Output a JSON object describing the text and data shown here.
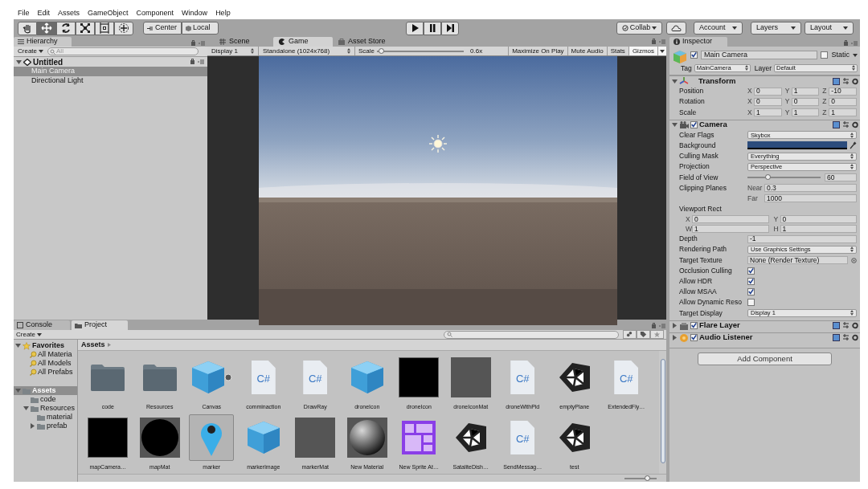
{
  "menu": [
    "File",
    "Edit",
    "Assets",
    "GameObject",
    "Component",
    "Window",
    "Help"
  ],
  "toolbar": {
    "tools": [
      {
        "kind": "hand",
        "selected": false
      },
      {
        "kind": "move",
        "selected": true
      },
      {
        "kind": "rotate",
        "selected": false
      },
      {
        "kind": "scale",
        "selected": false
      },
      {
        "kind": "rect",
        "selected": false
      },
      {
        "kind": "transform",
        "selected": false
      }
    ],
    "pivot": [
      "Center",
      "Local"
    ],
    "collab": "Collab",
    "account": "Account",
    "layers": "Layers",
    "layout": "Layout"
  },
  "hierarchy": {
    "tab": "Hierarchy",
    "create": "Create",
    "search_placeholder": "All",
    "scene": {
      "name": "Untitled",
      "expanded": true,
      "children": [
        {
          "name": "Main Camera",
          "selected": true
        },
        {
          "name": "Directional Light",
          "selected": false
        }
      ]
    }
  },
  "center_tabs": [
    {
      "kind": "scene",
      "label": "Scene",
      "selected": false
    },
    {
      "kind": "game",
      "label": "Game",
      "selected": true
    },
    {
      "kind": "store",
      "label": "Asset Store",
      "selected": false
    }
  ],
  "game_bar": {
    "display": "Display 1",
    "resolution": "Standalone (1024x768)",
    "scale": {
      "label": "Scale",
      "level": 0.02,
      "reading": "0.6x"
    },
    "toggles": [
      {
        "label": "Maximize On Play",
        "on": false
      },
      {
        "label": "Mute Audio",
        "on": false
      },
      {
        "label": "Stats",
        "on": false
      },
      {
        "label": "Gizmos",
        "on": true
      }
    ]
  },
  "inspector": {
    "tab": "Inspector",
    "object": {
      "active": true,
      "name": "Main Camera",
      "static": false,
      "static_label": "Static",
      "tag_label": "Tag",
      "tag": "MainCamera",
      "layer_label": "Layer",
      "layer": "Default"
    },
    "components": [
      {
        "kind": "transform",
        "name": "Transform",
        "expanded": true,
        "rows": [
          {
            "kind": "vector",
            "label": "Position",
            "fields": [
              {
                "axis": "X",
                "value": "0"
              },
              {
                "axis": "Y",
                "value": "1"
              },
              {
                "axis": "Z",
                "value": "-10"
              }
            ]
          },
          {
            "kind": "vector",
            "label": "Rotation",
            "fields": [
              {
                "axis": "X",
                "value": "0"
              },
              {
                "axis": "Y",
                "value": "0"
              },
              {
                "axis": "Z",
                "value": "0"
              }
            ]
          },
          {
            "kind": "vector",
            "label": "Scale",
            "fields": [
              {
                "axis": "X",
                "value": "1"
              },
              {
                "axis": "Y",
                "value": "1"
              },
              {
                "axis": "Z",
                "value": "1"
              }
            ]
          }
        ]
      },
      {
        "kind": "camera",
        "name": "Camera",
        "expanded": true,
        "enabled": true,
        "rows": [
          {
            "kind": "dropdown",
            "label": "Clear Flags",
            "value": "Skybox"
          },
          {
            "kind": "color",
            "label": "Background",
            "color": "#2c4c7c"
          },
          {
            "kind": "dropdown",
            "label": "Culling Mask",
            "value": "Everything"
          },
          {
            "kind": "dropdown",
            "label": "Projection",
            "value": "Perspective"
          },
          {
            "kind": "slider",
            "label": "Field of View",
            "level": 0.28,
            "value": "60"
          },
          {
            "kind": "stack",
            "label": "Clipping Planes",
            "fields": [
              {
                "axis": "Near",
                "value": "0.3"
              },
              {
                "axis": "Far",
                "value": "1000"
              }
            ]
          },
          {
            "kind": "heading",
            "label": "Viewport Rect"
          },
          {
            "kind": "grid",
            "fields": [
              {
                "axis": "X",
                "value": "0"
              },
              {
                "axis": "Y",
                "value": "0"
              },
              {
                "axis": "W",
                "value": "1"
              },
              {
                "axis": "H",
                "value": "1"
              }
            ]
          },
          {
            "kind": "text",
            "label": "Depth",
            "value": "-1"
          },
          {
            "kind": "dropdown",
            "label": "Rendering Path",
            "value": "Use Graphics Settings"
          },
          {
            "kind": "object",
            "label": "Target Texture",
            "value": "None (Render Texture)"
          },
          {
            "kind": "checkbox",
            "label": "Occlusion Culling",
            "checked": true
          },
          {
            "kind": "checkbox",
            "label": "Allow HDR",
            "checked": true
          },
          {
            "kind": "checkbox",
            "label": "Allow MSAA",
            "checked": true
          },
          {
            "kind": "checkbox",
            "label": "Allow Dynamic Reso",
            "checked": false
          },
          {
            "kind": "dropdown",
            "label": "Target Display",
            "value": "Display 1"
          }
        ]
      },
      {
        "kind": "flare",
        "name": "Flare Layer",
        "expanded": false,
        "enabled": true
      },
      {
        "kind": "audio",
        "name": "Audio Listener",
        "expanded": false,
        "enabled": true
      }
    ],
    "add_component": "Add Component"
  },
  "bottom_tabs": [
    {
      "kind": "console",
      "label": "Console",
      "selected": false
    },
    {
      "kind": "project",
      "label": "Project",
      "selected": true
    }
  ],
  "project": {
    "create": "Create",
    "favorites": {
      "name": "Favorites",
      "expanded": true,
      "children": [
        {
          "name": "All Materia"
        },
        {
          "name": "All Models"
        },
        {
          "name": "All Prefabs"
        }
      ]
    },
    "tree": {
      "name": "Assets",
      "selected": true,
      "expanded": true,
      "children": [
        {
          "name": "code"
        },
        {
          "name": "Resources",
          "expanded": true,
          "children": [
            {
              "name": "material"
            },
            {
              "name": "prefab",
              "expanded": false
            }
          ]
        }
      ]
    },
    "breadcrumb": "Assets",
    "zoom": {
      "level": 0.7
    },
    "assets": [
      {
        "name": "code",
        "kind": "folder",
        "selected": false
      },
      {
        "name": "Resources",
        "kind": "folder",
        "selected": false
      },
      {
        "name": "Canvas",
        "kind": "prefab",
        "selected": false
      },
      {
        "name": "comminaction",
        "kind": "script",
        "icon_text": "C#",
        "selected": false
      },
      {
        "name": "DrawRay",
        "kind": "script",
        "icon_text": "C#",
        "selected": false
      },
      {
        "name": "droneIcon",
        "kind": "model",
        "selected": false
      },
      {
        "name": "droneIcon",
        "kind": "texture",
        "selected": false
      },
      {
        "name": "droneIconMat",
        "kind": "material",
        "selected": false
      },
      {
        "name": "droneWithPid",
        "kind": "script",
        "icon_text": "C#",
        "selected": false
      },
      {
        "name": "emptyPlane",
        "kind": "scene",
        "selected": false
      },
      {
        "name": "ExtendedFly…",
        "kind": "script",
        "icon_text": "C#",
        "selected": false
      },
      {
        "name": "mapCamera…",
        "kind": "texture",
        "selected": false
      },
      {
        "name": "mapMat",
        "kind": "disc",
        "selected": false
      },
      {
        "name": "marker",
        "kind": "pin",
        "selected": true
      },
      {
        "name": "markerImage",
        "kind": "model",
        "selected": false
      },
      {
        "name": "markerMat",
        "kind": "material",
        "selected": false
      },
      {
        "name": "New Material",
        "kind": "sphere",
        "selected": false
      },
      {
        "name": "New Sprite At…",
        "kind": "atlas",
        "selected": false
      },
      {
        "name": "SataliteDish…",
        "kind": "scene",
        "selected": false
      },
      {
        "name": "SendMessag…",
        "kind": "script",
        "icon_text": "C#",
        "selected": false
      },
      {
        "name": "test",
        "kind": "scene",
        "selected": false
      }
    ]
  }
}
